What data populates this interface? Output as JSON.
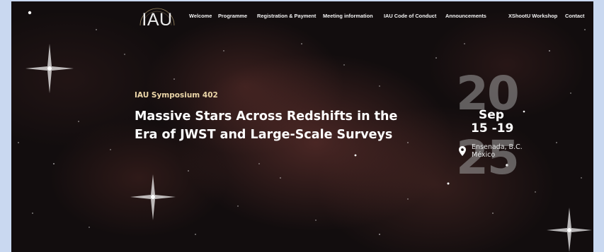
{
  "header": {
    "logo_text": "IAU",
    "nav": [
      {
        "label": "Welcome"
      },
      {
        "label": "Programme"
      },
      {
        "label": "Registration & Payment"
      },
      {
        "label": "Meeting information"
      },
      {
        "label": "IAU Code of Conduct"
      },
      {
        "label": "Announcements"
      },
      {
        "label": "XShootU Workshop"
      },
      {
        "label": "Contact"
      }
    ]
  },
  "hero": {
    "eyebrow": "IAU Symposium 402",
    "title": "Massive Stars Across Redshifts in the Era of JWST and Large-Scale Surveys",
    "year_top": "20",
    "year_bottom": "25",
    "month": "Sep",
    "days": "15 -19",
    "location_line1": "Ensenada, B.C.",
    "location_line2": "México",
    "location_icon": "map-pin-icon"
  },
  "colors": {
    "eyebrow": "#ecd6a8",
    "frame": "#c9d8f0",
    "background": "#120d0e"
  }
}
